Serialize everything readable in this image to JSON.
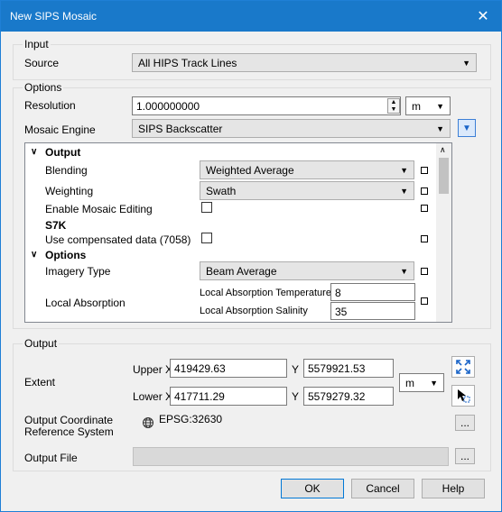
{
  "window": {
    "title": "New SIPS Mosaic",
    "close_glyph": "✕"
  },
  "input_group": {
    "title": "Input",
    "source_label": "Source",
    "source_value": "All HIPS Track Lines"
  },
  "options_group": {
    "title": "Options",
    "resolution_label": "Resolution",
    "resolution_value": "1.000000000",
    "resolution_unit": "m",
    "engine_label": "Mosaic Engine",
    "engine_value": "SIPS Backscatter"
  },
  "tree": {
    "output_header": "Output",
    "blending_label": "Blending",
    "blending_value": "Weighted Average",
    "weighting_label": "Weighting",
    "weighting_value": "Swath",
    "mosaic_editing_label": "Enable Mosaic Editing",
    "s7k_header": "S7K",
    "compensated_label": "Use compensated data (7058)",
    "options_header": "Options",
    "imagery_label": "Imagery Type",
    "imagery_value": "Beam Average",
    "absorption_label": "Local Absorption",
    "temp_label": "Local Absorption Temperature",
    "temp_value": "8",
    "salinity_label": "Local Absorption Salinity",
    "salinity_value": "35"
  },
  "output_group": {
    "title": "Output",
    "extent_label": "Extent",
    "upper_x_label": "Upper X",
    "upper_x_value": "419429.63",
    "upper_y_label": "Y",
    "upper_y_value": "5579921.53",
    "lower_x_label": "Lower X",
    "lower_x_value": "417711.29",
    "lower_y_label": "Y",
    "lower_y_value": "5579279.32",
    "extent_unit": "m",
    "crs_label_1": "Output Coordinate",
    "crs_label_2": "Reference System",
    "crs_value": "EPSG:32630",
    "file_label": "Output File",
    "browse_label": "..."
  },
  "buttons": {
    "ok": "OK",
    "cancel": "Cancel",
    "help": "Help"
  },
  "colors": {
    "titlebar": "#1979ca",
    "accent": "#0078d7"
  }
}
